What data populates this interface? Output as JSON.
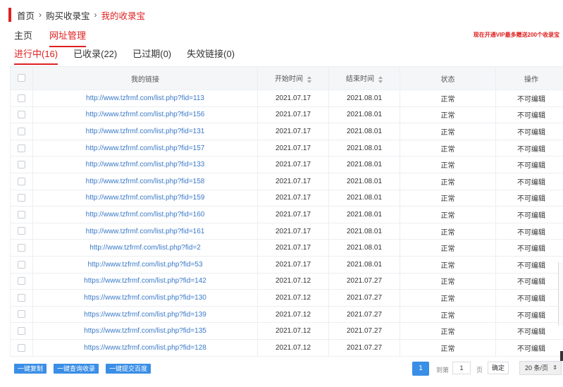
{
  "breadcrumb": {
    "items": [
      "首页",
      "购买收录宝"
    ],
    "current": "我的收录宝",
    "separator": "›"
  },
  "top_tabs": [
    {
      "label": "主页",
      "active": false
    },
    {
      "label": "网址管理",
      "active": true
    }
  ],
  "promo_text": "现在开通VIP最多赠送200个收录宝",
  "sub_tabs": [
    {
      "label": "进行中(16)",
      "active": true
    },
    {
      "label": "已收录(22)",
      "active": false
    },
    {
      "label": "已过期(0)",
      "active": false
    },
    {
      "label": "失效链接(0)",
      "active": false
    }
  ],
  "table": {
    "headers": [
      "我的链接",
      "开始时间",
      "结束时间",
      "状态",
      "操作"
    ],
    "rows": [
      [
        "http://www.tzfrmf.com/list.php?fid=113",
        "2021.07.17",
        "2021.08.01",
        "正常",
        "不可编辑"
      ],
      [
        "http://www.tzfrmf.com/list.php?fid=156",
        "2021.07.17",
        "2021.08.01",
        "正常",
        "不可编辑"
      ],
      [
        "http://www.tzfrmf.com/list.php?fid=131",
        "2021.07.17",
        "2021.08.01",
        "正常",
        "不可编辑"
      ],
      [
        "http://www.tzfrmf.com/list.php?fid=157",
        "2021.07.17",
        "2021.08.01",
        "正常",
        "不可编辑"
      ],
      [
        "http://www.tzfrmf.com/list.php?fid=133",
        "2021.07.17",
        "2021.08.01",
        "正常",
        "不可编辑"
      ],
      [
        "http://www.tzfrmf.com/list.php?fid=158",
        "2021.07.17",
        "2021.08.01",
        "正常",
        "不可编辑"
      ],
      [
        "http://www.tzfrmf.com/list.php?fid=159",
        "2021.07.17",
        "2021.08.01",
        "正常",
        "不可编辑"
      ],
      [
        "http://www.tzfrmf.com/list.php?fid=160",
        "2021.07.17",
        "2021.08.01",
        "正常",
        "不可编辑"
      ],
      [
        "http://www.tzfrmf.com/list.php?fid=161",
        "2021.07.17",
        "2021.08.01",
        "正常",
        "不可编辑"
      ],
      [
        "http://www.tzfrmf.com/list.php?fid=2",
        "2021.07.17",
        "2021.08.01",
        "正常",
        "不可编辑"
      ],
      [
        "http://www.tzfrmf.com/list.php?fid=53",
        "2021.07.17",
        "2021.08.01",
        "正常",
        "不可编辑"
      ],
      [
        "https://www.tzfrmf.com/list.php?fid=142",
        "2021.07.12",
        "2021.07.27",
        "正常",
        "不可编辑"
      ],
      [
        "https://www.tzfrmf.com/list.php?fid=130",
        "2021.07.12",
        "2021.07.27",
        "正常",
        "不可编辑"
      ],
      [
        "https://www.tzfrmf.com/list.php?fid=139",
        "2021.07.12",
        "2021.07.27",
        "正常",
        "不可编辑"
      ],
      [
        "https://www.tzfrmf.com/list.php?fid=135",
        "2021.07.12",
        "2021.07.27",
        "正常",
        "不可编辑"
      ],
      [
        "https://www.tzfrmf.com/list.php?fid=128",
        "2021.07.12",
        "2021.07.27",
        "正常",
        "不可编辑"
      ]
    ]
  },
  "actions": {
    "copy_label": "一键复制",
    "query_label": "一键查询收录",
    "submit_label": "一键提交百度"
  },
  "pagination": {
    "current_page": "1",
    "goto_label": "到第",
    "goto_value": "1",
    "page_unit": "页",
    "confirm_label": "确定",
    "page_size": "20 条/页"
  },
  "colors": {
    "accent": "#e02020",
    "link": "#3a79c8",
    "button": "#3a8ee6"
  }
}
